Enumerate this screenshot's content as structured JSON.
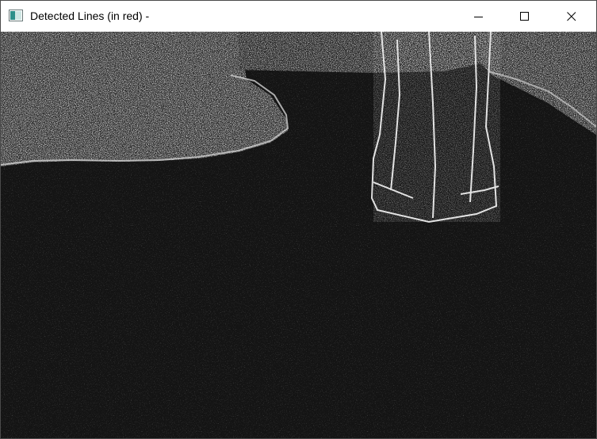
{
  "window": {
    "title": "Detected Lines (in red) -",
    "buttons": {
      "minimize": "minimize-icon",
      "maximize": "maximize-icon",
      "close": "close-icon"
    }
  },
  "image": {
    "description_colors": {
      "background": "#1a1a1a",
      "edges": "#d8d8d8"
    }
  }
}
